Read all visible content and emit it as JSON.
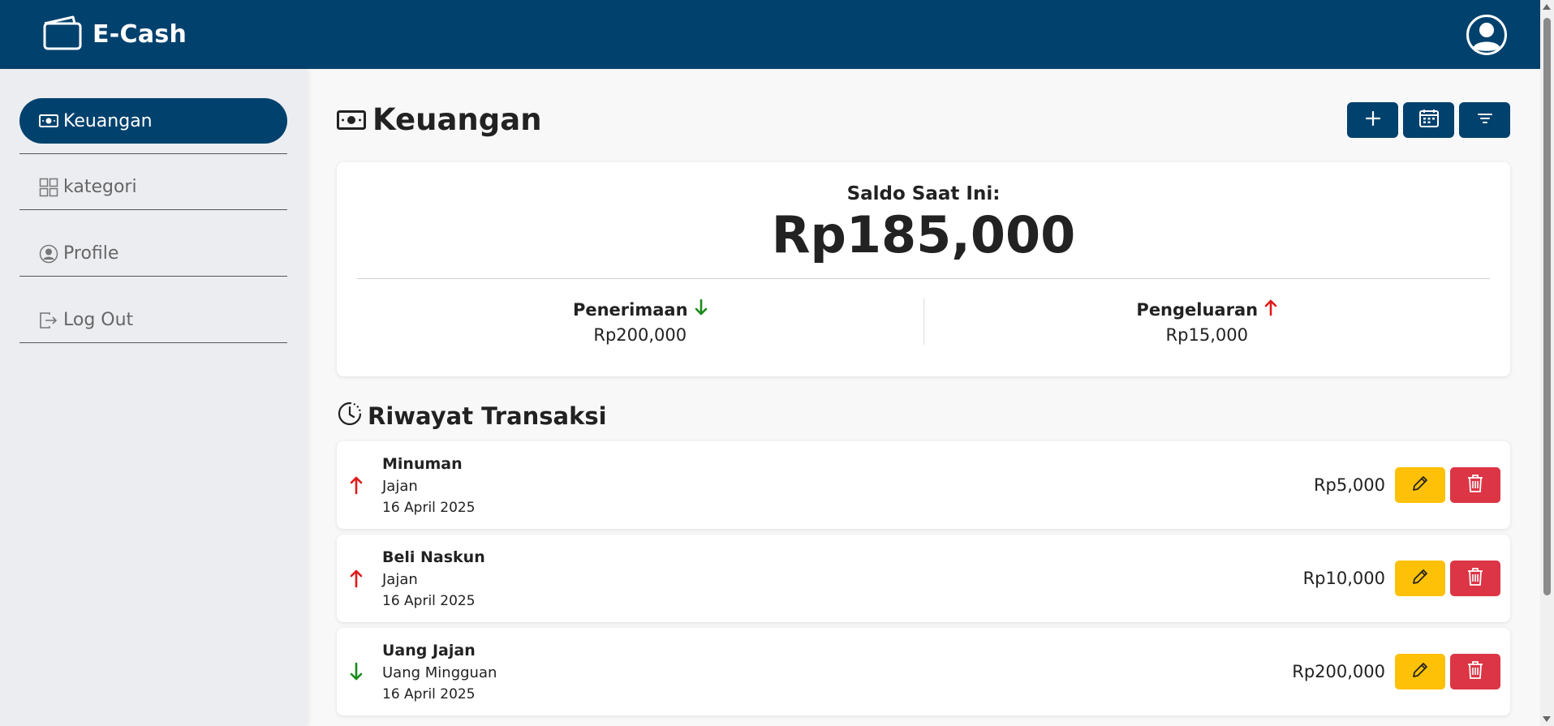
{
  "app": {
    "name": "E-Cash"
  },
  "sidebar": {
    "items": [
      {
        "label": "Keuangan",
        "icon": "money-icon"
      },
      {
        "label": "kategori",
        "icon": "grid-icon"
      },
      {
        "label": "Profile",
        "icon": "user-circle-icon"
      },
      {
        "label": "Log Out",
        "icon": "logout-icon"
      }
    ]
  },
  "page": {
    "title": "Keuangan",
    "actions": [
      "plus-icon",
      "calendar-icon",
      "filter-icon"
    ]
  },
  "balance": {
    "label": "Saldo Saat Ini:",
    "value": "Rp185,000",
    "income_label": "Penerimaan",
    "income_value": "Rp200,000",
    "expense_label": "Pengeluaran",
    "expense_value": "Rp15,000"
  },
  "history": {
    "title": "Riwayat Transaksi",
    "transactions": [
      {
        "name": "Minuman",
        "category": "Jajan",
        "date": "16 April 2025",
        "amount": "Rp5,000",
        "direction": "out"
      },
      {
        "name": "Beli Naskun",
        "category": "Jajan",
        "date": "16 April 2025",
        "amount": "Rp10,000",
        "direction": "out"
      },
      {
        "name": "Uang Jajan",
        "category": "Uang Mingguan",
        "date": "16 April 2025",
        "amount": "Rp200,000",
        "direction": "in"
      }
    ]
  },
  "colors": {
    "primary": "#01416d",
    "income": "#1a8a1a",
    "expense": "#e01a1a",
    "edit": "#fec107",
    "delete": "#dc3545"
  }
}
